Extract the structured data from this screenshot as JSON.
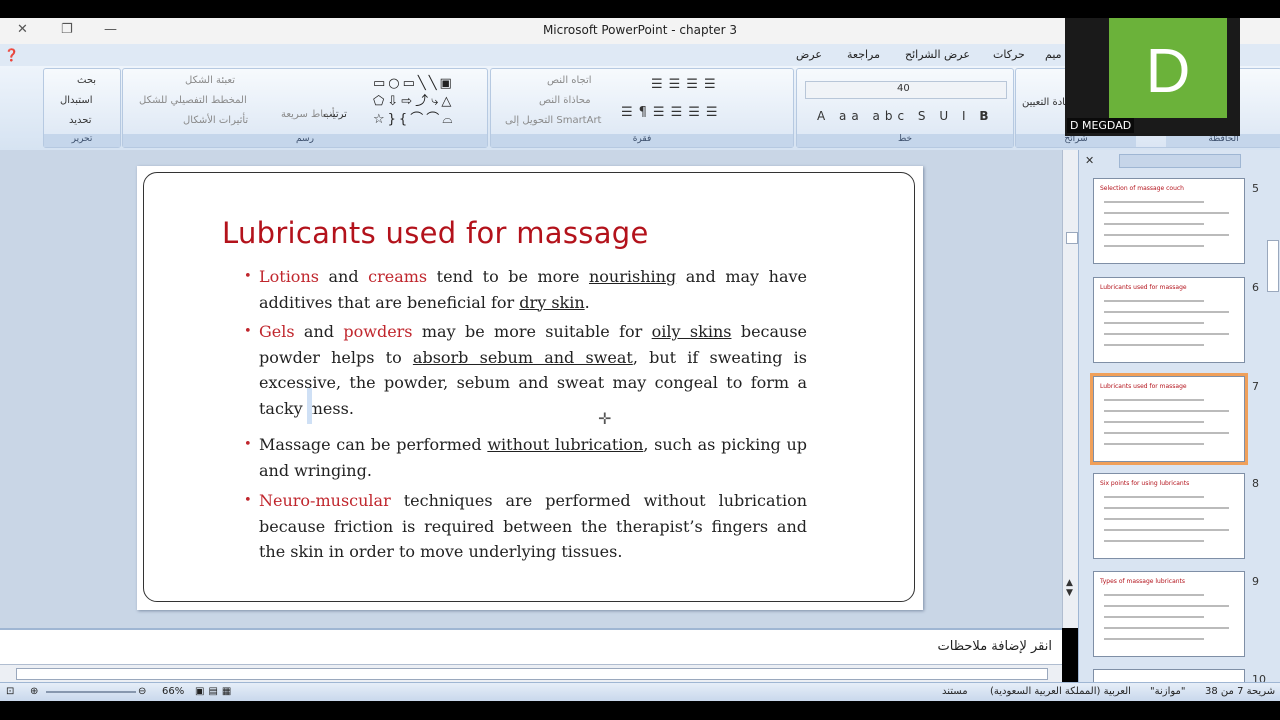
{
  "window": {
    "title": "Microsoft PowerPoint - chapter 3"
  },
  "ribbon_tabs": [
    "ميم",
    "حركات",
    "عرض الشرائح",
    "مراجعة",
    "عرض"
  ],
  "ribbon": {
    "editing": {
      "label": "تحرير",
      "find": "بحث",
      "replace": "استبدال",
      "select": "تحديد"
    },
    "drawing": {
      "label": "رسم",
      "shape_fill": "تعبئة الشكل",
      "shape_outline": "المخطط التفصيلي للشكل",
      "shape_effects": "تأثيرات الأشكال",
      "quick_styles": "أنماط سريعة",
      "arrange": "ترتيب"
    },
    "paragraph": {
      "label": "فقرة",
      "text_direction": "اتجاه النص",
      "align_text": "محاذاة النص",
      "smartart": "التحويل إلى SmartArt"
    },
    "font": {
      "label": "خط",
      "size": "40"
    },
    "slides": {
      "label": "شرائح",
      "reset": "إعادة التعيين"
    },
    "clipboard": {
      "label": "الحافظة"
    }
  },
  "slide": {
    "title": "Lubricants used for  massage",
    "bullets": [
      {
        "parts": [
          {
            "t": "Lotions",
            "c": "red"
          },
          {
            "t": " and "
          },
          {
            "t": "creams",
            "c": "red"
          },
          {
            "t": " tend to be more "
          },
          {
            "t": "nourishing",
            "c": "ul"
          },
          {
            "t": " and may have additives that are beneficial for "
          },
          {
            "t": "dry skin",
            "c": "ul"
          },
          {
            "t": "."
          }
        ]
      },
      {
        "parts": [
          {
            "t": "Gels",
            "c": "red"
          },
          {
            "t": " and "
          },
          {
            "t": "powders",
            "c": "red"
          },
          {
            "t": " may be more suitable for "
          },
          {
            "t": "oily skins",
            "c": "ul"
          },
          {
            "t": " because powder helps to "
          },
          {
            "t": "absorb sebum and sweat",
            "c": "ul"
          },
          {
            "t": ", but if sweating is excessive, the powder, sebum and sweat may congeal to form a tacky mess."
          }
        ]
      },
      {
        "parts": [
          {
            "t": "Massage can be performed "
          },
          {
            "t": "without lubrication",
            "c": "ul"
          },
          {
            "t": ", such as picking up and wringing."
          }
        ]
      },
      {
        "parts": [
          {
            "t": "Neuro-muscular",
            "c": "red"
          },
          {
            "t": " techniques are performed without lubrication because friction is required between the therapist’s fingers and the skin in order to move underlying tissues."
          }
        ]
      }
    ]
  },
  "notes": {
    "placeholder": "انقر لإضافة ملاحظات"
  },
  "thumbnails": [
    {
      "num": "5",
      "title": "Selection of massage couch"
    },
    {
      "num": "6",
      "title": "Lubricants used for  massage"
    },
    {
      "num": "7",
      "title": "Lubricants used for  massage",
      "selected": true
    },
    {
      "num": "8",
      "title": "Six points for using lubricants"
    },
    {
      "num": "9",
      "title": "Types of massage lubricants"
    },
    {
      "num": "10",
      "title": ""
    }
  ],
  "status": {
    "slide_info": "شريحة 7 من 38",
    "theme": "\"موازنة\"",
    "language": "العربية (المملكة العربية السعودية)",
    "ready": "مستند",
    "zoom": "66%"
  },
  "webcam": {
    "initial": "D",
    "name": "D MEGDAD",
    "tile_color": "#6bb23a"
  }
}
